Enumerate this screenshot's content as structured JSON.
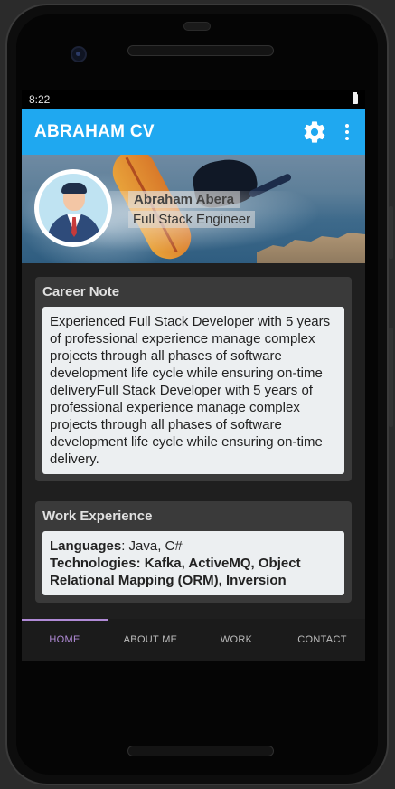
{
  "status_bar": {
    "time": "8:22"
  },
  "app_bar": {
    "title": "ABRAHAM CV",
    "settings_icon": "gear-icon",
    "menu_icon": "more-vert-icon"
  },
  "profile": {
    "name": "Abraham Abera",
    "role": "Full Stack Engineer"
  },
  "career_note": {
    "title": "Career Note",
    "text": "Experienced Full Stack Developer with 5 years of professional experience manage complex projects through all phases of software development life cycle while ensuring on-time deliveryFull Stack Developer with 5 years of professional experience manage complex projects through all phases of software development life cycle while ensuring on-time delivery."
  },
  "work_experience": {
    "title": "Work Experience",
    "languages_label": "Languages",
    "languages_value": ": Java, C#",
    "technologies_label": "Technologies",
    "technologies_value": ": Kafka, ActiveMQ, Object Relational Mapping (ORM), Inversion"
  },
  "bottom_nav": {
    "items": [
      {
        "label": "HOME",
        "active": true
      },
      {
        "label": "ABOUT ME",
        "active": false
      },
      {
        "label": "WORK",
        "active": false
      },
      {
        "label": "CONTACT",
        "active": false
      }
    ]
  },
  "colors": {
    "primary": "#1fa8f0",
    "accent": "#b08ad6",
    "background": "#1f1f1f",
    "card": "#3a3a3a"
  }
}
